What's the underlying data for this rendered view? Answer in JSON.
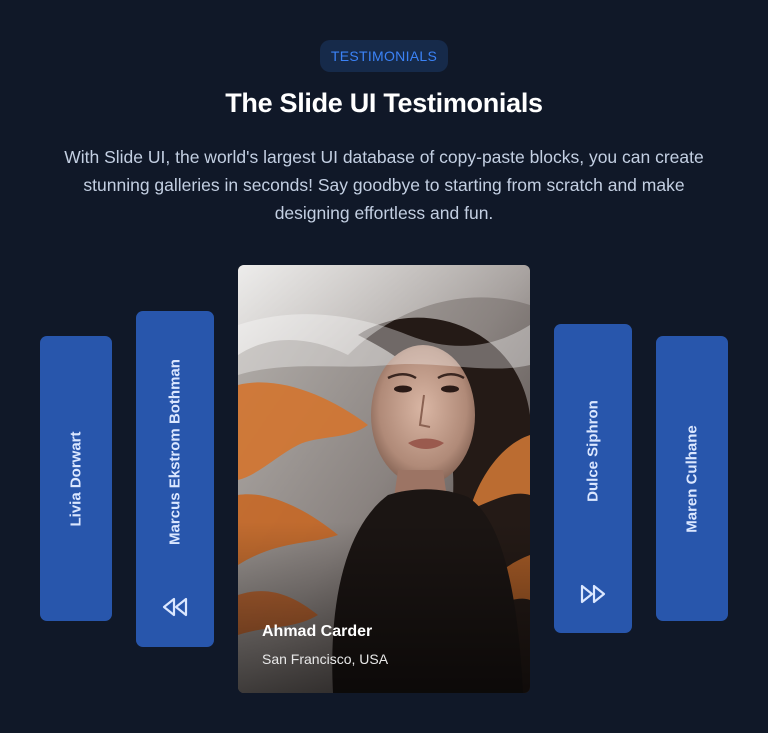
{
  "header": {
    "badge": "TESTIMONIALS",
    "title": "The Slide UI Testimonials",
    "description": "With Slide UI, the world's largest UI database of copy-paste blocks, you can create stunning galleries in seconds! Say goodbye to starting from scratch and make designing effortless and fun."
  },
  "slides": {
    "left_outer": {
      "name": "Livia Dorwart"
    },
    "left_inner": {
      "name": "Marcus Ekstrom Bothman",
      "control_icon": "rewind-icon"
    },
    "featured": {
      "name": "Ahmad Carder",
      "location": "San Francisco, USA",
      "image": "portrait-photo"
    },
    "right_inner": {
      "name": "Dulce Siphron",
      "control_icon": "fast-forward-icon"
    },
    "right_outer": {
      "name": "Maren Culhane"
    }
  },
  "colors": {
    "background": "#101828",
    "card": "#2856ac",
    "badge_bg": "#162a4a",
    "badge_text": "#3b82f6"
  }
}
